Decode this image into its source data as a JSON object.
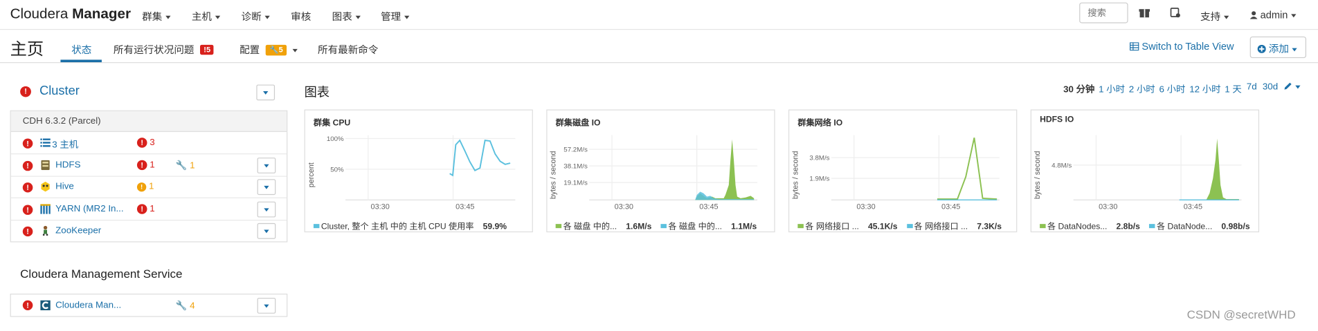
{
  "nav": {
    "brand_a": "Cloudera",
    "brand_b": "Manager",
    "menus": [
      "群集",
      "主机",
      "诊断",
      "审核",
      "图表",
      "管理"
    ],
    "search_placeholder": "搜索",
    "support": "支持",
    "user": "admin"
  },
  "page": {
    "title": "主页",
    "tabs": {
      "status": "状态",
      "health": "所有运行状况问题",
      "health_badge": "5",
      "config": "配置",
      "config_badge": "5",
      "commands": "所有最新命令"
    },
    "switch_view": "Switch to Table View",
    "add": "添加"
  },
  "cluster": {
    "name": "Cluster",
    "version": "CDH 6.3.2 (Parcel)",
    "rows": [
      {
        "name": "3 主机",
        "icon": "hosts-icon",
        "err": "3",
        "warn": "",
        "config": ""
      },
      {
        "name": "HDFS",
        "icon": "hdfs-icon",
        "err": "1",
        "warn": "",
        "config": "1"
      },
      {
        "name": "Hive",
        "icon": "hive-icon",
        "err": "",
        "warn": "1",
        "config": ""
      },
      {
        "name": "YARN (MR2 In...",
        "icon": "yarn-icon",
        "err": "1",
        "warn": "",
        "config": ""
      },
      {
        "name": "ZooKeeper",
        "icon": "zookeeper-icon",
        "err": "",
        "warn": "",
        "config": ""
      }
    ]
  },
  "mgmt": {
    "title": "Cloudera Management Service",
    "row": {
      "name": "Cloudera Man...",
      "icon": "cloudera-icon",
      "config": "4"
    }
  },
  "charts_section": {
    "title": "图表",
    "ranges": [
      "30 分钟",
      "1 小时",
      "2 小时",
      "6 小时",
      "12 小时",
      "1 天",
      "7d",
      "30d"
    ],
    "active_range": "30 分钟"
  },
  "chart_data": [
    {
      "type": "line",
      "title": "群集 CPU",
      "ylabel": "percent",
      "yticks": [
        "100%",
        "50%"
      ],
      "xticks": [
        "03:30",
        "03:45"
      ],
      "ylim": [
        0,
        100
      ],
      "series": [
        {
          "name": "Cluster, 整个 主机 中的 主机 CPU 使用率",
          "value": "59.9%",
          "color": "#5bc0de",
          "x": [
            0.0,
            0.03,
            0.06,
            0.1,
            0.15,
            0.2,
            0.25,
            0.3,
            0.35,
            0.4,
            0.45,
            0.5,
            0.55,
            0.6
          ],
          "y": [
            43,
            40,
            90,
            97,
            80,
            62,
            48,
            52,
            97,
            96,
            75,
            63,
            58,
            60
          ]
        }
      ]
    },
    {
      "type": "area",
      "title": "群集磁盘 IO",
      "ylabel": "bytes / second",
      "yticks": [
        "57.2M/s",
        "38.1M/s",
        "19.1M/s"
      ],
      "xticks": [
        "03:30",
        "03:45"
      ],
      "series": [
        {
          "name": "各 磁盘 中的...",
          "value": "1.6M/s",
          "color": "#8cc152"
        },
        {
          "name": "各 磁盘 中的...",
          "value": "1.1M/s",
          "color": "#5bc0de"
        }
      ]
    },
    {
      "type": "line",
      "title": "群集网络 IO",
      "ylabel": "bytes / second",
      "yticks": [
        "3.8M/s",
        "1.9M/s"
      ],
      "xticks": [
        "03:30",
        "03:45"
      ],
      "series": [
        {
          "name": "各 网络接口 ...",
          "value": "45.1K/s",
          "color": "#8cc152"
        },
        {
          "name": "各 网络接口 ...",
          "value": "7.3K/s",
          "color": "#5bc0de"
        }
      ]
    },
    {
      "type": "area",
      "title": "HDFS IO",
      "ylabel": "bytes / second",
      "yticks": [
        "4.8M/s"
      ],
      "xticks": [
        "03:30",
        "03:45"
      ],
      "series": [
        {
          "name": "各 DataNodes...",
          "value": "2.8b/s",
          "color": "#8cc152"
        },
        {
          "name": "各 DataNode...",
          "value": "0.98b/s",
          "color": "#5bc0de"
        }
      ]
    }
  ],
  "watermark": "CSDN @secretWHD"
}
